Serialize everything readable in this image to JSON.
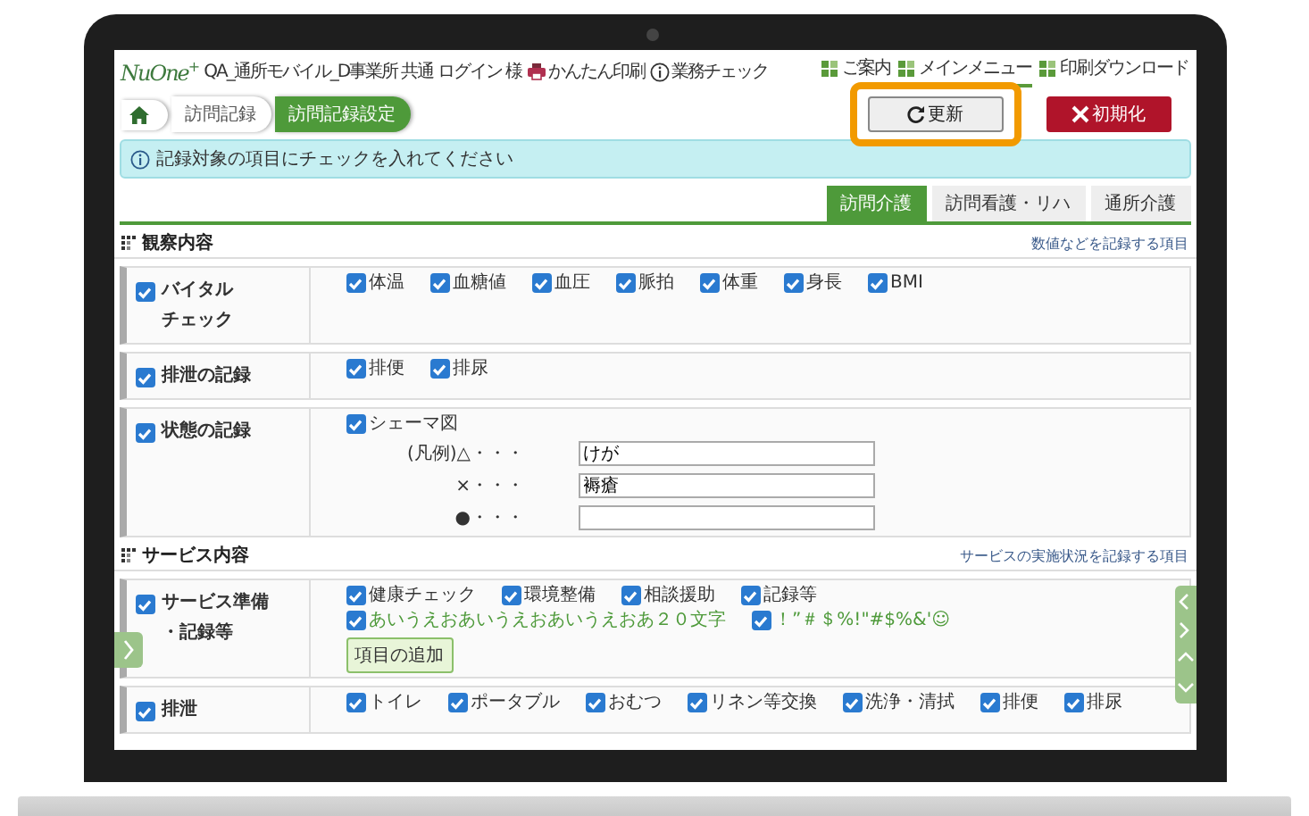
{
  "header": {
    "logo": "NuOne",
    "logo_mark": "+",
    "user": "QA_通所モバイル_D事業所 共通 ログイン 様",
    "tools": [
      {
        "kind": "printer",
        "label": "かんたん印刷"
      },
      {
        "kind": "info",
        "label": "業務チェック"
      }
    ],
    "menu": [
      {
        "label": "ご案内",
        "selected": false
      },
      {
        "label": "メインメニュー",
        "selected": true
      },
      {
        "label": "印刷ダウンロード",
        "selected": false
      }
    ]
  },
  "breadcrumb": [
    {
      "label": "訪問記録",
      "selected": false
    },
    {
      "label": "訪問記録設定",
      "selected": true
    }
  ],
  "buttons": [
    {
      "kind": "refresh",
      "label": "更新",
      "highlighted": true
    },
    {
      "kind": "reset",
      "label": "初期化",
      "highlighted": false
    }
  ],
  "notice": "記録対象の項目にチェックを入れてください",
  "tabs": [
    {
      "label": "訪問介護",
      "selected": true
    },
    {
      "label": "訪問看護・リハ",
      "selected": false
    },
    {
      "label": "通所介護",
      "selected": false
    }
  ],
  "sections": [
    {
      "title": "観察内容",
      "link": "数値などを記録する項目",
      "groups": [
        {
          "label_lines": [
            "バイタル",
            "チェック"
          ],
          "checked": true,
          "items": [
            {
              "kind": "check",
              "label": "体温",
              "checked": true,
              "custom": false
            },
            {
              "kind": "check",
              "label": "血糖値",
              "checked": true,
              "custom": false
            },
            {
              "kind": "check",
              "label": "血圧",
              "checked": true,
              "custom": false
            },
            {
              "kind": "check",
              "label": "脈拍",
              "checked": true,
              "custom": false
            },
            {
              "kind": "check",
              "label": "体重",
              "checked": true,
              "custom": false
            },
            {
              "kind": "check",
              "label": "身長",
              "checked": true,
              "custom": false
            },
            {
              "kind": "check",
              "label": "BMI",
              "checked": true,
              "custom": false
            }
          ]
        },
        {
          "label_lines": [
            "排泄の記録"
          ],
          "checked": true,
          "items": [
            {
              "kind": "check",
              "label": "排便",
              "checked": true,
              "custom": false
            },
            {
              "kind": "check",
              "label": "排尿",
              "checked": true,
              "custom": false
            }
          ]
        },
        {
          "label_lines": [
            "状態の記録"
          ],
          "checked": true,
          "items": [
            {
              "kind": "check",
              "label": "シェーマ図",
              "checked": true,
              "custom": false
            },
            {
              "kind": "legend",
              "label": "(凡例)△・・・",
              "value": "けが"
            },
            {
              "kind": "legend",
              "label": "×・・・",
              "value": "褥瘡"
            },
            {
              "kind": "legend",
              "label": "●・・・",
              "value": ""
            }
          ]
        }
      ]
    },
    {
      "title": "サービス内容",
      "link": "サービスの実施状況を記録する項目",
      "groups": [
        {
          "label_lines": [
            "サービス準備",
            "・記録等"
          ],
          "checked": true,
          "items": [
            {
              "kind": "check",
              "label": "健康チェック",
              "checked": true,
              "custom": false
            },
            {
              "kind": "check",
              "label": "環境整備",
              "checked": true,
              "custom": false
            },
            {
              "kind": "check",
              "label": "相談援助",
              "checked": true,
              "custom": false
            },
            {
              "kind": "check",
              "label": "記録等",
              "checked": true,
              "custom": false
            },
            {
              "kind": "break"
            },
            {
              "kind": "check",
              "label": "あいうえおあいうえおあいうえおあ２０文字",
              "checked": true,
              "custom": true
            },
            {
              "kind": "check",
              "label": "！”＃＄%!\"#$%&'☺",
              "checked": true,
              "custom": true
            },
            {
              "kind": "break"
            },
            {
              "kind": "button",
              "label": "項目の追加"
            }
          ]
        },
        {
          "label_lines": [
            "排泄"
          ],
          "checked": true,
          "items": [
            {
              "kind": "check",
              "label": "トイレ",
              "checked": true,
              "custom": false
            },
            {
              "kind": "check",
              "label": "ポータブル",
              "checked": true,
              "custom": false
            },
            {
              "kind": "check",
              "label": "おむつ",
              "checked": true,
              "custom": false
            },
            {
              "kind": "check",
              "label": "リネン等交換",
              "checked": true,
              "custom": false
            },
            {
              "kind": "check",
              "label": "洗浄・清拭",
              "checked": true,
              "custom": false
            },
            {
              "kind": "check",
              "label": "排便",
              "checked": true,
              "custom": false
            },
            {
              "kind": "check",
              "label": "排尿",
              "checked": true,
              "custom": false
            }
          ]
        }
      ]
    }
  ]
}
